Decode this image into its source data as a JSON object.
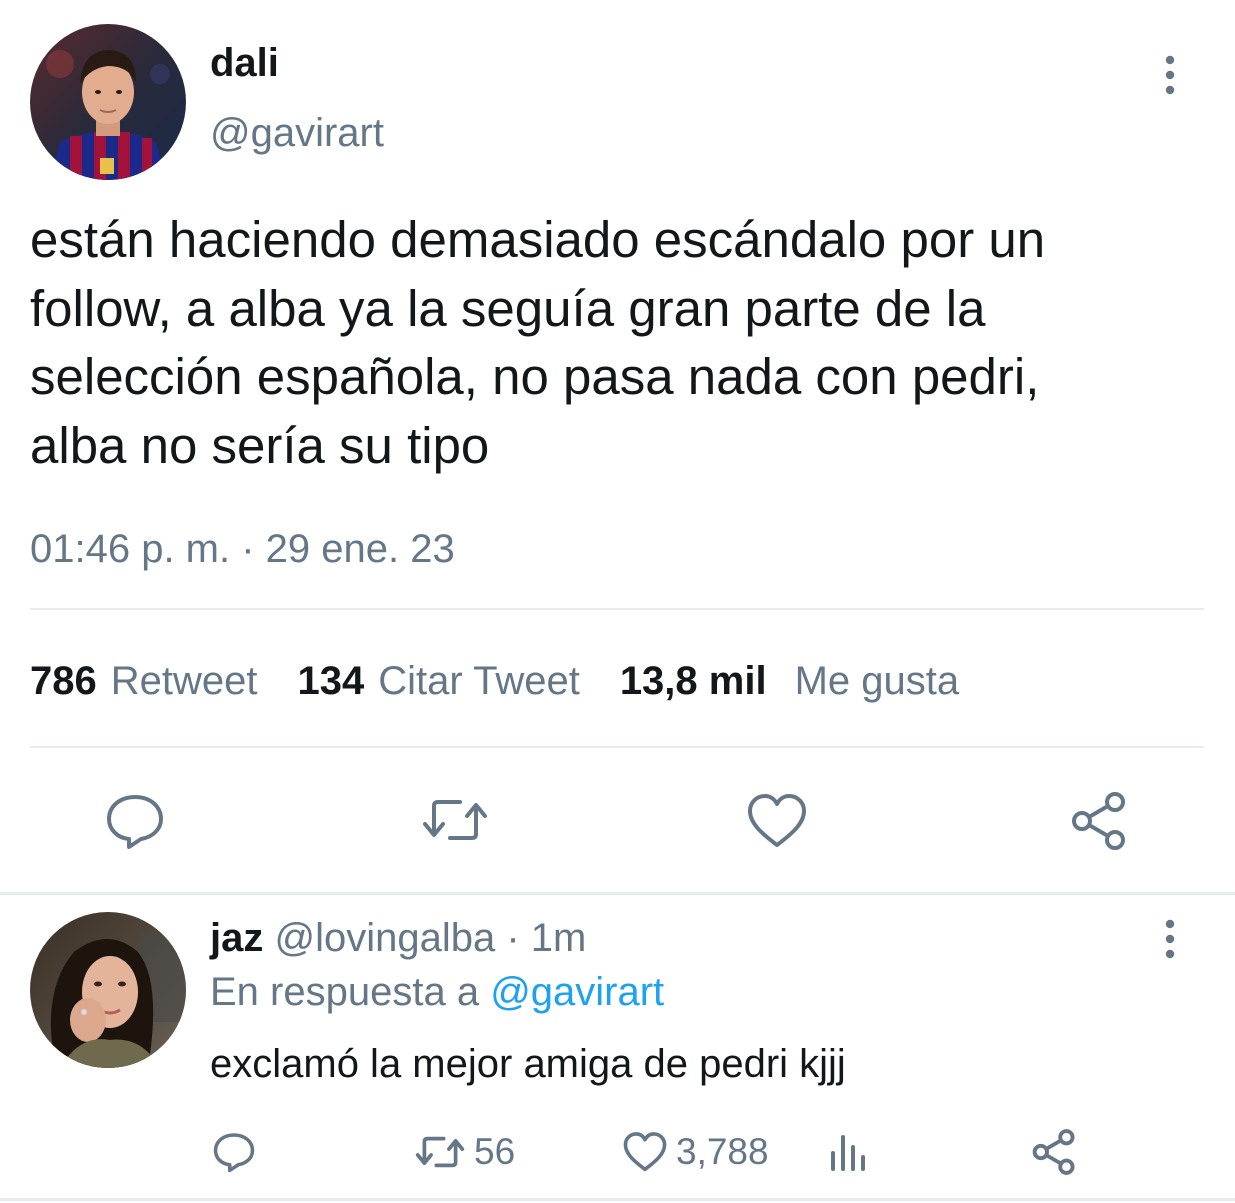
{
  "tweet": {
    "author_name": "dali",
    "author_handle": "@gavirart",
    "text": "están haciendo demasiado escándalo por un\nfollow, a alba ya la seguía gran parte de la\nselección española, no pasa nada con pedri,\nalba no sería su tipo",
    "timestamp": "01:46 p. m. · 29 ene. 23",
    "stats": {
      "retweets_count": "786",
      "retweets_label": "Retweet",
      "quotes_count": "134",
      "quotes_label": "Citar Tweet",
      "likes_count": "13,8 mil",
      "likes_label": "Me gusta"
    },
    "actions": [
      "reply-icon",
      "retweet-icon",
      "like-icon",
      "share-icon"
    ]
  },
  "reply": {
    "author_name": "jaz",
    "author_handle": "@lovingalba",
    "separator": " · ",
    "time": "1m",
    "reply_to_prefix": "En respuesta a ",
    "reply_to_handle": "@gavirart",
    "text": "exclamó la mejor amiga de pedri kjjj",
    "retweets": "56",
    "likes": "3,788"
  },
  "colors": {
    "text": "#14171a",
    "secondary": "#657786",
    "accent": "#1da1f2",
    "divider": "#e6ecf0"
  }
}
